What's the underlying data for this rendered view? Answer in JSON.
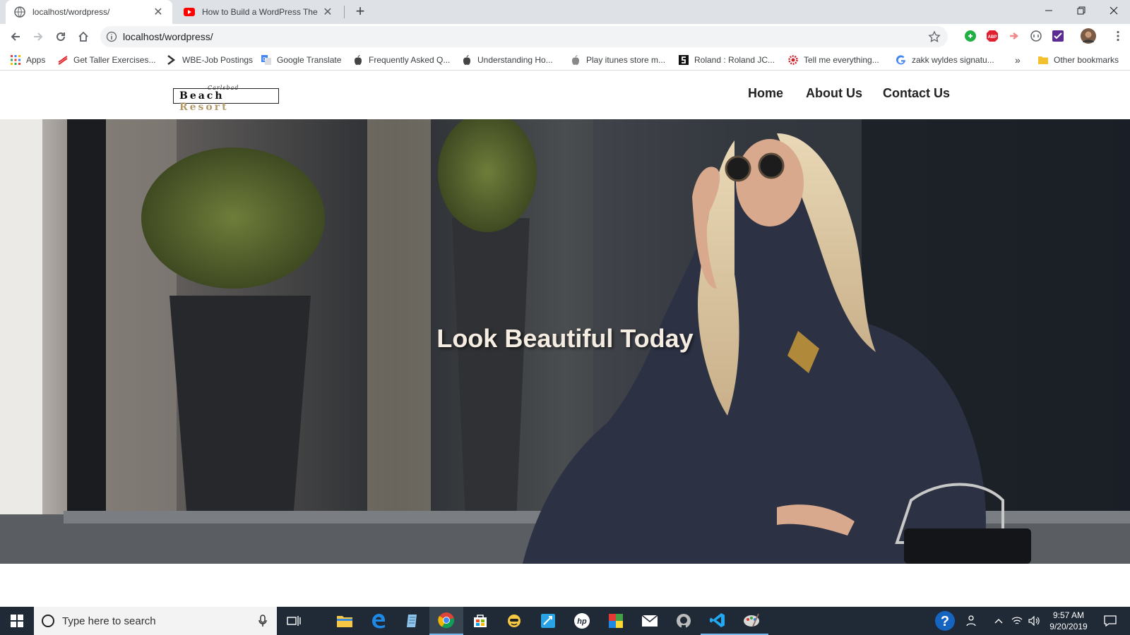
{
  "browser": {
    "tabs": [
      {
        "title": "localhost/wordpress/",
        "active": true
      },
      {
        "title": "How to Build a WordPress Theme",
        "active": false
      }
    ],
    "url": "localhost/wordpress/",
    "bookmarks": [
      {
        "label": "Apps",
        "icon": "apps-grid-icon"
      },
      {
        "label": "Get Taller Exercises...",
        "icon": "get-taller-icon"
      },
      {
        "label": "WBE-Job Postings",
        "icon": "wbe-icon"
      },
      {
        "label": "Google Translate",
        "icon": "google-translate-icon"
      },
      {
        "label": "Frequently Asked Q...",
        "icon": "apple-icon"
      },
      {
        "label": "Understanding Ho...",
        "icon": "apple-icon"
      },
      {
        "label": "Play itunes store m...",
        "icon": "apple-icon"
      },
      {
        "label": "Roland : Roland JC...",
        "icon": "roland-icon"
      },
      {
        "label": "Tell me everything...",
        "icon": "gear-red-icon"
      },
      {
        "label": "zakk wyldes signatu...",
        "icon": "google-icon"
      }
    ],
    "bookmarks_overflow": "»",
    "other_bookmarks": "Other bookmarks"
  },
  "site": {
    "logo_main_1": "Beach",
    "logo_main_2": "Resort",
    "logo_sub": "Carlsbad",
    "nav": [
      "Home",
      "About Us",
      "Contact Us"
    ],
    "hero_title": "Look Beautiful Today"
  },
  "taskbar": {
    "search_placeholder": "Type here to search",
    "time": "9:57 AM",
    "date": "9/20/2019"
  },
  "colors": {
    "accent": "#b49a6a",
    "taskbar": "#1f2a36",
    "tab_bg": "#dee1e6"
  }
}
